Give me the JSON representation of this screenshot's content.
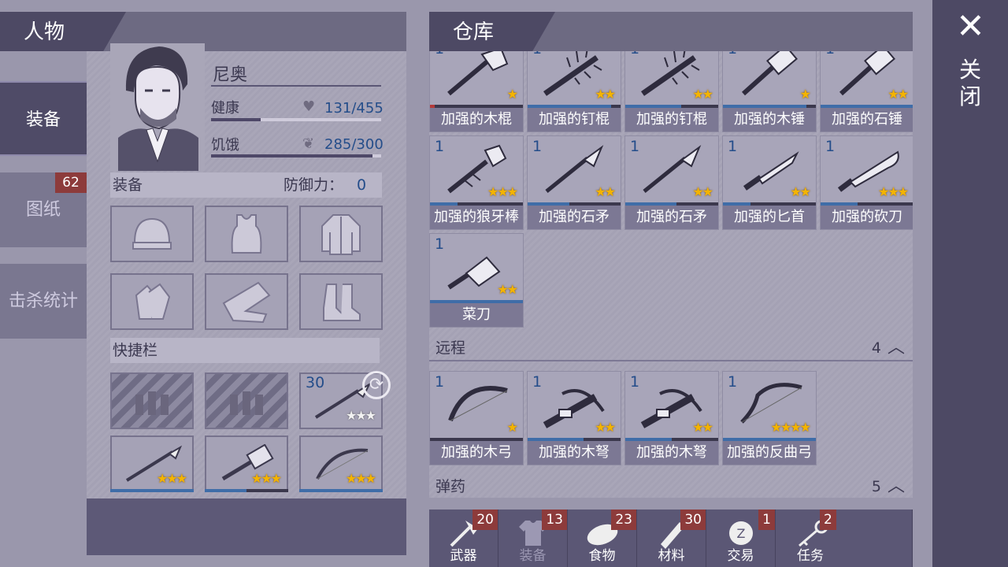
{
  "character_panel": {
    "title": "人物",
    "side_tabs": [
      {
        "label": "装备",
        "active": true
      },
      {
        "label": "图纸",
        "badge": "62"
      },
      {
        "label": "击杀统计"
      }
    ],
    "name": "尼奥",
    "health": {
      "label": "健康",
      "value": "131/455",
      "fraction": 0.29
    },
    "hunger": {
      "label": "饥饿",
      "value": "285/300",
      "fraction": 0.95
    },
    "equipment": {
      "label": "装备",
      "defense_label": "防御力：",
      "defense_value": "0"
    },
    "quickbar": {
      "label": "快捷栏",
      "spear_count": "30"
    }
  },
  "warehouse": {
    "title": "仓库",
    "melee_items": [
      {
        "count": "1",
        "name": "加强的木棍",
        "stars": "★"
      },
      {
        "count": "1",
        "name": "加强的钉棍",
        "stars": "★★"
      },
      {
        "count": "1",
        "name": "加强的钉棍",
        "stars": "★★"
      },
      {
        "count": "1",
        "name": "加强的木锤",
        "stars": "★"
      },
      {
        "count": "1",
        "name": "加强的石锤",
        "stars": "★★"
      },
      {
        "count": "1",
        "name": "加强的狼牙棒",
        "stars": "★★★"
      },
      {
        "count": "1",
        "name": "加强的石矛",
        "stars": "★★"
      },
      {
        "count": "1",
        "name": "加强的石矛",
        "stars": "★★"
      },
      {
        "count": "1",
        "name": "加强的匕首",
        "stars": "★★"
      },
      {
        "count": "1",
        "name": "加强的砍刀",
        "stars": "★★★"
      },
      {
        "count": "1",
        "name": "菜刀",
        "stars": "★★"
      }
    ],
    "ranged": {
      "label": "远程",
      "count": "4",
      "items": [
        {
          "count": "1",
          "name": "加强的木弓",
          "stars": "★"
        },
        {
          "count": "1",
          "name": "加强的木弩",
          "stars": "★★"
        },
        {
          "count": "1",
          "name": "加强的木弩",
          "stars": "★★"
        },
        {
          "count": "1",
          "name": "加强的反曲弓",
          "stars": "★★★★"
        }
      ]
    },
    "ammo": {
      "label": "弹药",
      "count": "5"
    },
    "bottom_tabs": [
      {
        "label": "武器",
        "badge": "20"
      },
      {
        "label": "装备",
        "badge": "13"
      },
      {
        "label": "食物",
        "badge": "23"
      },
      {
        "label": "材料",
        "badge": "30"
      },
      {
        "label": "交易",
        "badge": "1"
      },
      {
        "label": "任务",
        "badge": "2"
      }
    ]
  },
  "close": {
    "label": "关闭"
  },
  "colors": {
    "panel_dark": "#4d4964",
    "accent_blue": "#3f6da8",
    "star": "#f4b400",
    "badge_red": "#8d3b3b"
  }
}
